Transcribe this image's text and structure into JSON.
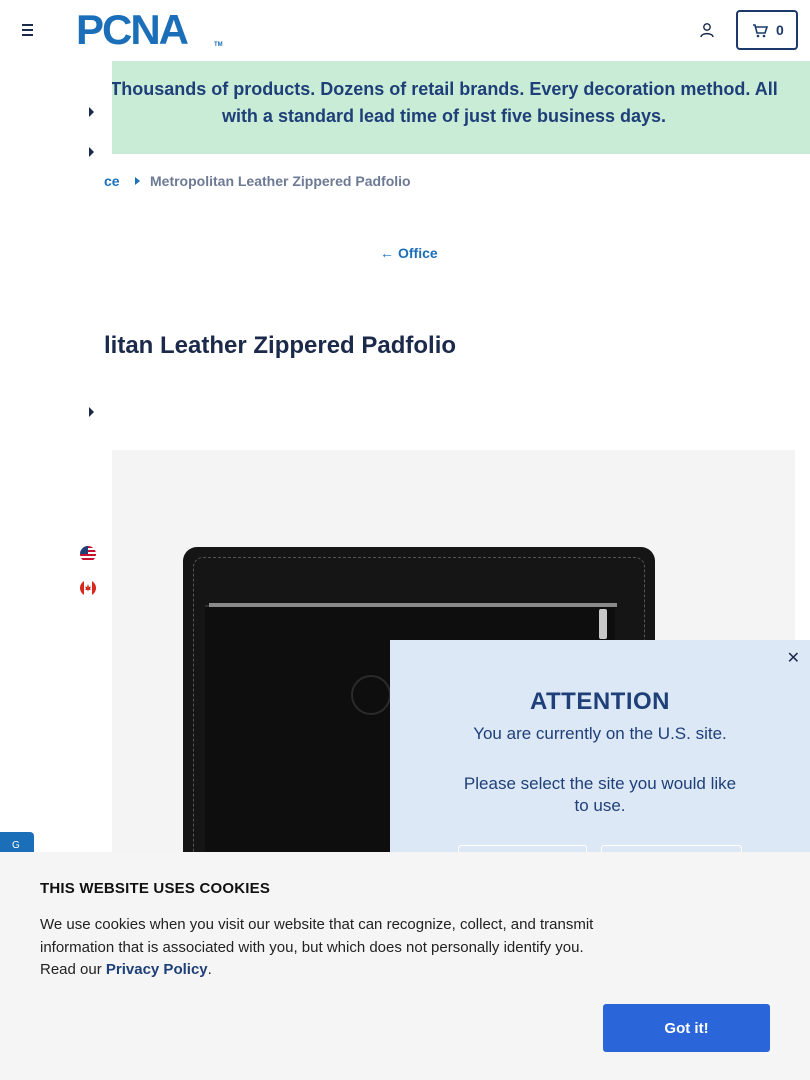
{
  "header": {
    "logo_text": "PCNA",
    "logo_tm": "TM",
    "cart_count": "0"
  },
  "promo": {
    "text": "Thousands of products. Dozens of retail brands. Every decoration method. All with a standard lead time of just five business days."
  },
  "breadcrumb": {
    "previous": "ce",
    "current": "Metropolitan Leather Zippered Padfolio"
  },
  "back_link": {
    "label": "Office"
  },
  "product": {
    "title": "litan Leather Zippered Padfolio"
  },
  "attention": {
    "title": "ATTENTION",
    "message": "You are currently on the U.S. site.",
    "prompt": "Please select the site you would like to use."
  },
  "cookie": {
    "heading": "THIS WEBSITE USES COOKIES",
    "body": "We use cookies when you visit our website that can recognize, collect, and transmit information that is associated with you, but which does not personally identify you. Read our",
    "link": "Privacy Policy",
    "period": ".",
    "button": "Got it!"
  },
  "side_tab": {
    "label": "G"
  },
  "colors": {
    "brand_blue": "#1a6fb8",
    "navy": "#1e3f78",
    "promo_bg": "#c9ecd6",
    "cookie_button": "#2a66d9",
    "attention_bg": "#dde8f6"
  }
}
